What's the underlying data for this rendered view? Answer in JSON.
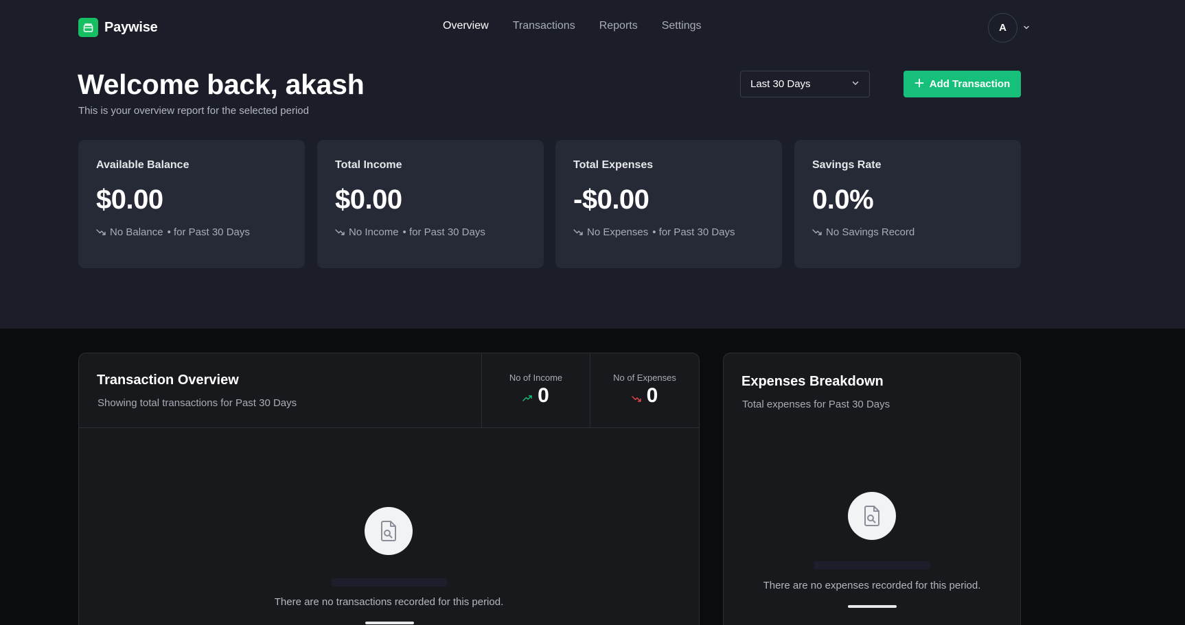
{
  "brand": {
    "name": "Paywise",
    "accent": "#16c07a"
  },
  "nav": {
    "items": [
      {
        "label": "Overview",
        "active": true
      },
      {
        "label": "Transactions",
        "active": false
      },
      {
        "label": "Reports",
        "active": false
      },
      {
        "label": "Settings",
        "active": false
      }
    ]
  },
  "user": {
    "initial": "A"
  },
  "header": {
    "welcome": "Welcome back, akash",
    "subtitle": "This is your overview report for the selected period",
    "period": "Last 30 Days",
    "add_label": "Add Transaction"
  },
  "stats": [
    {
      "title": "Available Balance",
      "value": "$0.00",
      "note": "No Balance",
      "period": "• for Past 30 Days"
    },
    {
      "title": "Total Income",
      "value": "$0.00",
      "note": "No Income",
      "period": "• for Past 30 Days"
    },
    {
      "title": "Total Expenses",
      "value": "-$0.00",
      "note": "No Expenses",
      "period": "• for Past 30 Days"
    },
    {
      "title": "Savings Rate",
      "value": "0.0%",
      "note": "No Savings Record",
      "period": ""
    }
  ],
  "transactions": {
    "title": "Transaction Overview",
    "subtitle": "Showing total transactions for Past 30 Days",
    "income_label": "No of Income",
    "income_count": "0",
    "expense_label": "No of Expenses",
    "expense_count": "0",
    "empty_text": "There are no transactions recorded for this period."
  },
  "breakdown": {
    "title": "Expenses Breakdown",
    "subtitle": "Total expenses for Past 30 Days",
    "empty_text": "There are no expenses recorded for this period."
  }
}
